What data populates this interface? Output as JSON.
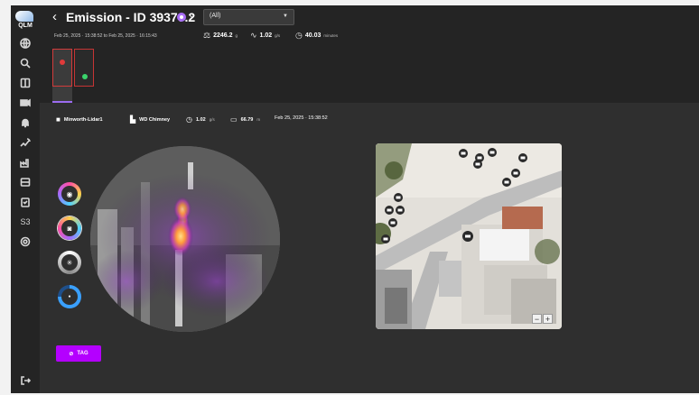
{
  "app": {
    "logo_text": "QLM"
  },
  "sidebar": {
    "items": [
      {
        "name": "globe-icon",
        "glyph": "◍"
      },
      {
        "name": "search-icon",
        "glyph": "⌕"
      },
      {
        "name": "book-icon",
        "glyph": "▥"
      },
      {
        "name": "camera-icon",
        "glyph": "■"
      },
      {
        "name": "bell-icon",
        "glyph": "▲"
      },
      {
        "name": "signal-icon",
        "glyph": "≈"
      },
      {
        "name": "factory-icon",
        "glyph": "⌂"
      },
      {
        "name": "server-icon",
        "glyph": "▤"
      },
      {
        "name": "clipboard-icon",
        "glyph": "▣"
      },
      {
        "name": "s3-icon",
        "glyph": "S3"
      },
      {
        "name": "settings-icon",
        "glyph": "◎"
      }
    ],
    "logout_icon": "→"
  },
  "header": {
    "title": "Emission - ID 39370.2",
    "filter_value": "(All)",
    "date_start": "Feb 25, 2025 · 15:38:52",
    "date_sep": "to",
    "date_end": "Feb 25, 2025 · 16:15:43",
    "stats": [
      {
        "value": "2246.2",
        "unit": "g"
      },
      {
        "value": "1.02",
        "unit": "g/s"
      },
      {
        "value": "40.03",
        "unit": "minutes"
      }
    ]
  },
  "detail": {
    "sensor": "Minworth-Lidar1",
    "source": "WD Chimney",
    "rate_value": "1.02",
    "rate_unit": "g/s",
    "distance_value": "66.79",
    "distance_unit": "m",
    "timestamp": "Feb 25, 2025 · 15:38:52"
  },
  "map": {
    "zoom_out": "−",
    "zoom_in": "+"
  },
  "tag_button": {
    "label": "TAG"
  },
  "colors": {
    "accent": "#b400ff",
    "title_dot": "#a76cf5",
    "thumb_red": "#e03a3a",
    "thumb_green": "#3ad36b"
  }
}
